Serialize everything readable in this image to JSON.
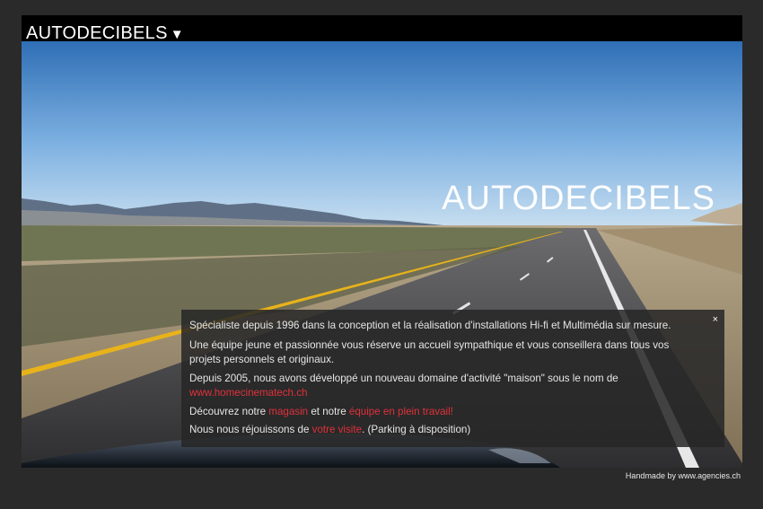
{
  "header": {
    "brand": "AUTODECIBELS",
    "dropdown_arrow": "▼"
  },
  "hero": {
    "title": "AUTODECIBELS"
  },
  "info_panel": {
    "close_label": "×",
    "line1": "Spécialiste depuis 1996 dans la conception et la réalisation d'installations Hi-fi et Multimédia sur mesure.",
    "line2": "Une équipe jeune et passionnée vous réserve un accueil sympathique et vous conseillera dans tous vos projets personnels et originaux.",
    "line3_text": "Depuis 2005, nous avons développé un nouveau domaine d'activité \"maison\" sous le nom de",
    "line3_link": "www.homecinematech.ch",
    "line4_prefix": "Découvrez notre ",
    "line4_link1": "magasin",
    "line4_middle": " et notre ",
    "line4_link2": "équipe en plein travail!",
    "line5_prefix": "Nous nous réjouissons de ",
    "line5_link": "votre visite",
    "line5_suffix": ". (Parking à disposition)"
  },
  "footer": {
    "credit": "Handmade by www.agencies.ch"
  },
  "colors": {
    "background": "#2a2a2a",
    "link": "#e0313a",
    "panel": "#262626"
  }
}
